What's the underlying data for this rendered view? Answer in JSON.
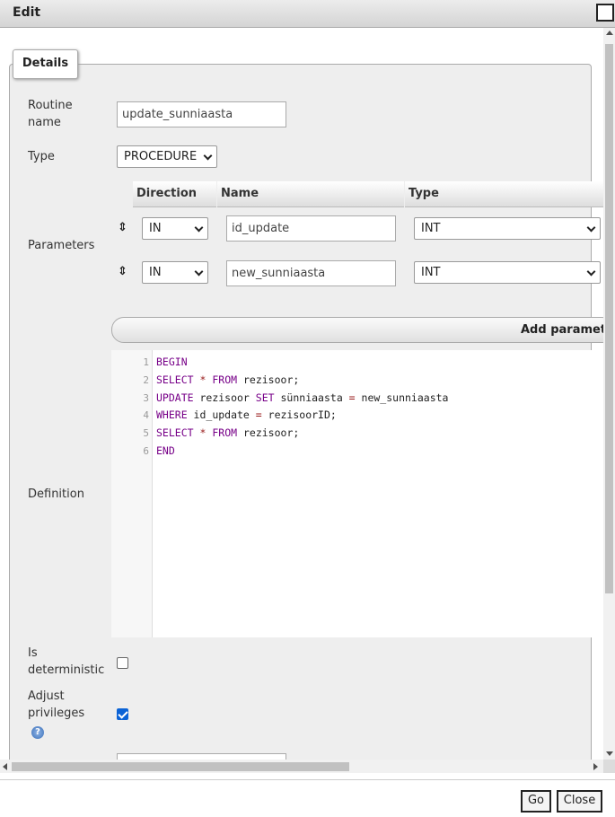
{
  "dialog": {
    "title": "Edit",
    "go_label": "Go",
    "close_label": "Close"
  },
  "details": {
    "legend": "Details",
    "routine_name_label": "Routine name",
    "routine_name_value": "update_sunniaasta",
    "type_label": "Type",
    "type_value": "PROCEDURE",
    "parameters_label": "Parameters",
    "param_headers": {
      "direction": "Direction",
      "name": "Name",
      "type": "Type"
    },
    "params": [
      {
        "direction": "IN",
        "name": "id_update",
        "type": "INT"
      },
      {
        "direction": "IN",
        "name": "new_sunniaasta",
        "type": "INT"
      }
    ],
    "add_parameter_label": "Add parameter",
    "definition_label": "Definition",
    "definition_lines": [
      "BEGIN",
      "SELECT * FROM rezisoor;",
      "UPDATE rezisoor SET sünniaasta = new_sunniaasta",
      "WHERE id_update = rezisoorID;",
      "SELECT * FROM rezisoor;",
      "END"
    ],
    "line_numbers": [
      "1",
      "2",
      "3",
      "4",
      "5",
      "6"
    ],
    "is_deterministic_label": "Is deterministic",
    "is_deterministic_checked": false,
    "adjust_privileges_label": "Adjust privileges",
    "adjust_privileges_checked": true,
    "help_icon": "help-icon"
  }
}
